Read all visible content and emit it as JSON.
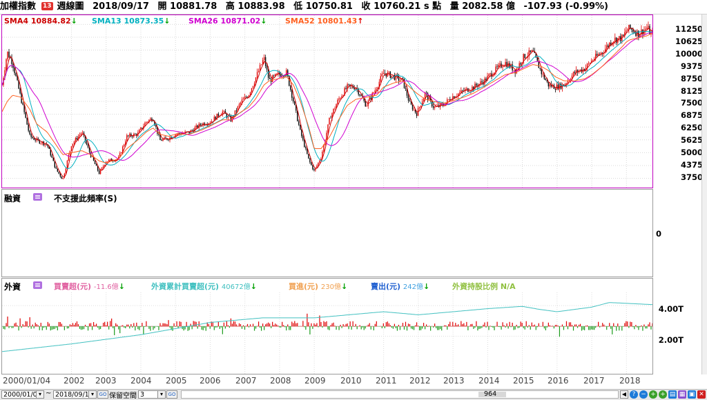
{
  "header": {
    "index_name": "加權指數",
    "badge": "13",
    "period": "週線圖",
    "date": "2018/09/17",
    "open_label": "開",
    "open": "10881.78",
    "high_label": "高",
    "high": "10883.98",
    "low_label": "低",
    "low": "10750.81",
    "close_label": "收",
    "close": "10760.21",
    "close_mark": "s",
    "points_unit": "點",
    "volume_label": "量",
    "volume": "2082.58",
    "volume_unit": "億",
    "change": "-107.93",
    "change_pct": "(-0.99%)"
  },
  "price_panel": {
    "legend": [
      {
        "label": "SMA4 10884.82",
        "arrow": "↓",
        "color": "#cc0000",
        "arrow_color": "#00a000"
      },
      {
        "label": "SMA13 10873.35",
        "arrow": "↓",
        "color": "#00b0c0",
        "arrow_color": "#00a000"
      },
      {
        "label": "SMA26 10871.02",
        "arrow": "↓",
        "color": "#d000d0",
        "arrow_color": "#00a000"
      },
      {
        "label": "SMA52 10801.43",
        "arrow": "↑",
        "color": "#ff6020",
        "arrow_color": "#e00000"
      }
    ],
    "y_ticks": [
      "11250",
      "10625",
      "10000",
      "9375",
      "8750",
      "8125",
      "7500",
      "6875",
      "6250",
      "5625",
      "5000",
      "4375",
      "3750"
    ]
  },
  "margin_panel": {
    "title": "融資",
    "message": "不支援此頻率(S)",
    "y_tick": "0"
  },
  "foreign_panel": {
    "title": "外資",
    "legend": [
      {
        "name": "買賣超(元)",
        "value": "-11.6億",
        "arrow": "↓",
        "color": "#e060a0"
      },
      {
        "name": "外資累計買賣超(元)",
        "value": "40672億",
        "arrow": "↓",
        "color": "#40c0c0"
      },
      {
        "name": "買進(元)",
        "value": "230億",
        "arrow": "↓",
        "color": "#f0a050"
      },
      {
        "name": "賣出(元)",
        "value": "242億",
        "arrow": "↓",
        "color": "#2060d0"
      },
      {
        "name": "外資持股比例",
        "value": "N/A",
        "arrow": "",
        "color": "#90c040"
      }
    ],
    "y_ticks": [
      "4.00T",
      "2.00T"
    ]
  },
  "x_axis": {
    "first_label": "2000/01/04",
    "years": [
      "2002",
      "2003",
      "2004",
      "2005",
      "2006",
      "2007",
      "2008",
      "2009",
      "2010",
      "2011",
      "2012",
      "2013",
      "2014",
      "2015",
      "2016",
      "2017",
      "2018"
    ]
  },
  "statusbar": {
    "start_date": "2000/01/04",
    "tilde": "~",
    "end_date": "2018/09/17",
    "go1": "GO",
    "keep_space_label": "保留空間",
    "keep_space_value": "3",
    "go2": "GO",
    "center_value": "964"
  },
  "chart_data": {
    "type": "line",
    "title": "",
    "xlabel": "",
    "ylabel": "",
    "x": [
      2000.0,
      2000.15,
      2000.3,
      2000.55,
      2000.8,
      2001.0,
      2001.3,
      2001.55,
      2001.75,
      2002.0,
      2002.3,
      2002.55,
      2002.8,
      2003.0,
      2003.35,
      2003.6,
      2003.9,
      2004.15,
      2004.35,
      2004.55,
      2004.8,
      2005.0,
      2005.4,
      2005.75,
      2006.0,
      2006.35,
      2006.6,
      2006.9,
      2007.1,
      2007.3,
      2007.55,
      2007.7,
      2007.95,
      2008.2,
      2008.4,
      2008.6,
      2008.85,
      2009.0,
      2009.2,
      2009.45,
      2009.7,
      2009.95,
      2010.2,
      2010.5,
      2010.8,
      2011.0,
      2011.3,
      2011.55,
      2011.75,
      2011.95,
      2012.2,
      2012.45,
      2012.7,
      2012.95,
      2013.3,
      2013.6,
      2013.9,
      2014.2,
      2014.5,
      2014.8,
      2015.05,
      2015.3,
      2015.55,
      2015.75,
      2015.95,
      2016.2,
      2016.5,
      2016.8,
      2017.0,
      2017.3,
      2017.6,
      2017.9,
      2018.0,
      2018.1,
      2018.35,
      2018.6,
      2018.71
    ],
    "series": [
      {
        "name": "加權指數",
        "values": [
          8300,
          9900,
          9400,
          7600,
          5800,
          5600,
          5400,
          4200,
          3700,
          5400,
          6000,
          4900,
          4000,
          4600,
          4700,
          5800,
          5900,
          6500,
          6700,
          5600,
          5700,
          5900,
          6000,
          6400,
          6500,
          7000,
          6600,
          7500,
          7800,
          8600,
          9600,
          8500,
          8800,
          8900,
          7500,
          6000,
          4600,
          4100,
          4800,
          6700,
          7600,
          8200,
          8200,
          7300,
          8200,
          8900,
          8700,
          8500,
          7400,
          6900,
          7900,
          7200,
          7300,
          7700,
          8000,
          8200,
          8500,
          9000,
          9400,
          9000,
          9700,
          9900,
          8900,
          8300,
          8200,
          8300,
          8900,
          9100,
          9500,
          9900,
          10500,
          10600,
          11000,
          11050,
          10800,
          11100,
          10760
        ]
      },
      {
        "name": "SMA52",
        "values": [
          7000,
          7500,
          7800,
          7700,
          7100,
          6400,
          6000,
          5400,
          4900,
          5000,
          5100,
          4900,
          4600,
          4500,
          4700,
          5200,
          5600,
          6000,
          6200,
          5900,
          5800,
          5900,
          5900,
          6100,
          6300,
          6600,
          6600,
          7000,
          7200,
          7600,
          8300,
          8500,
          8600,
          8700,
          8300,
          7500,
          6200,
          5200,
          5200,
          5800,
          6600,
          7300,
          7600,
          7700,
          7800,
          8200,
          8400,
          8500,
          8200,
          7900,
          7600,
          7500,
          7400,
          7500,
          7700,
          7900,
          8200,
          8500,
          8800,
          8900,
          9100,
          9300,
          9200,
          9000,
          8700,
          8500,
          8500,
          8600,
          8800,
          9200,
          9700,
          10200,
          10400,
          10500,
          10600,
          10700,
          10801
        ]
      }
    ],
    "ylim": [
      3300,
      11700
    ],
    "foreign_net_buy_billion_twd_last": -11.6,
    "foreign_cumulative_trillion": {
      "x": [
        2000.0,
        2002.0,
        2004.0,
        2006.0,
        2007.5,
        2009.0,
        2010.0,
        2011.0,
        2012.0,
        2013.0,
        2014.0,
        2015.0,
        2015.5,
        2016.0,
        2017.0,
        2017.5,
        2018.0,
        2018.71
      ],
      "values": [
        1.0,
        1.5,
        2.1,
        2.9,
        3.2,
        3.2,
        3.4,
        3.6,
        3.4,
        3.6,
        3.8,
        3.95,
        3.75,
        3.6,
        3.9,
        4.2,
        4.15,
        4.07
      ]
    },
    "foreign_axis_ticks": [
      "4.00T",
      "2.00T"
    ],
    "grid": true,
    "legend": "top-left"
  }
}
